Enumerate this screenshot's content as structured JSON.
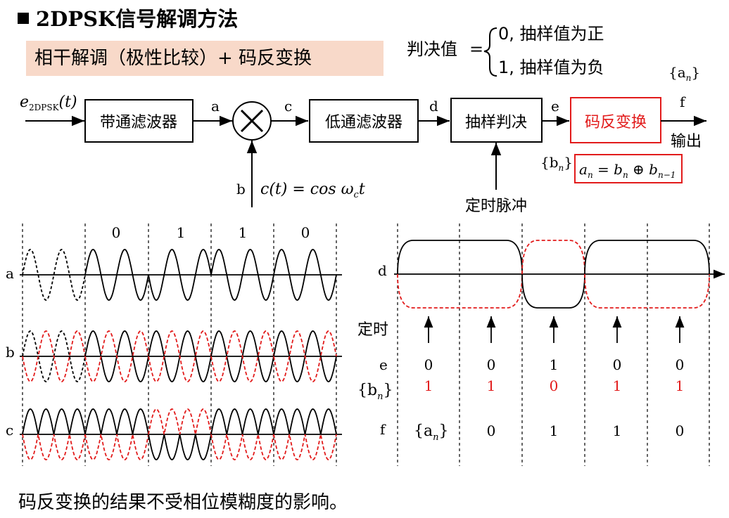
{
  "title": "2DPSK信号解调方法",
  "method": "相干解调（极性比较）+ 码反变换",
  "decision": {
    "lhs": "判决值",
    "eq": "=",
    "case0": "0,  抽样值为正",
    "case1": "1,  抽样值为负"
  },
  "blocks": {
    "input_e": "e",
    "input_sub": "2DPSK",
    "input_t": "(t)",
    "bpf": "带通滤波器",
    "mult_symbol": "×",
    "lpf": "低通滤波器",
    "sampler": "抽样判决",
    "code_inv": "码反变换",
    "output": "输出",
    "timing": "定时脉冲",
    "carrier": "c(t) = cos ω",
    "carrier_sub": "c",
    "carrier_t": "t",
    "an_top": "{a",
    "an_top_sub": "n",
    "an_top_close": "}",
    "bn_label": "{b",
    "bn_label_sub": "n",
    "bn_label_close": "}",
    "formula": "a",
    "formula_parts": [
      "n",
      " = b",
      "n",
      " ⊕ b",
      "n−1"
    ]
  },
  "points": {
    "a": "a",
    "b": "b",
    "c": "c",
    "d": "d",
    "e": "e",
    "f": "f"
  },
  "waves": {
    "bits": [
      "0",
      "1",
      "1",
      "0"
    ],
    "rows": [
      "a",
      "b",
      "c"
    ]
  },
  "decision_panel": {
    "d_label": "d",
    "timing_label": "定时",
    "e_label": "e",
    "e_values": [
      "0",
      "0",
      "1",
      "0",
      "0"
    ],
    "bn_row_label": "{b",
    "bn_row_sub": "n",
    "bn_row_close": "}",
    "bn_values": [
      "1",
      "1",
      "0",
      "1",
      "1"
    ],
    "f_label": "f",
    "an_row": "{a",
    "an_row_sub": "n",
    "an_row_close": "}",
    "f_values": [
      "0",
      "1",
      "1",
      "0"
    ]
  },
  "colors": {
    "red": "#e21b1b",
    "black": "#000000",
    "method_bg": "#f8d9c9"
  },
  "footer": "码反变换的结果不受相位模糊度的影响。"
}
